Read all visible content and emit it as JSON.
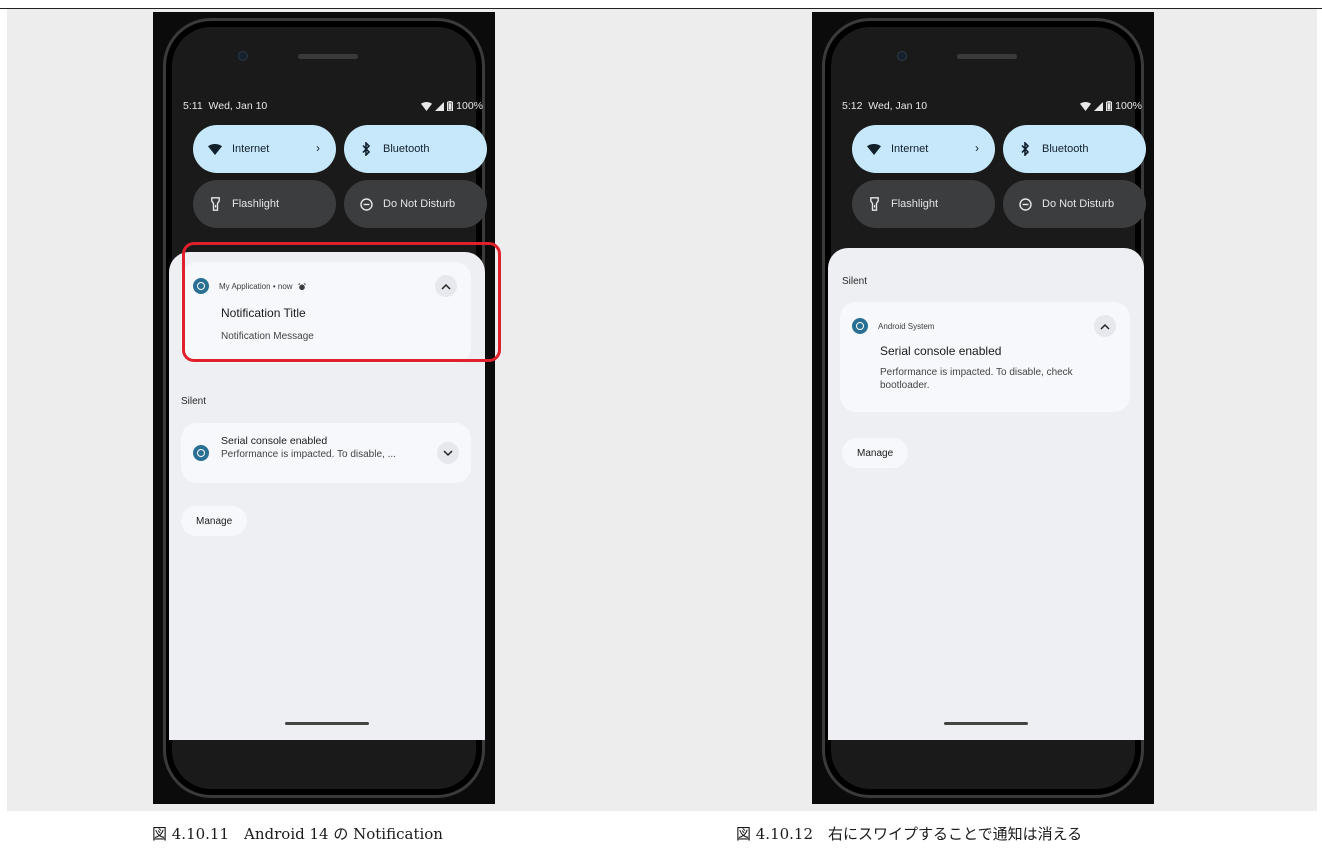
{
  "left": {
    "status": {
      "time": "5:11",
      "date": "Wed, Jan 10",
      "battery": "100%"
    },
    "tiles": {
      "internet": "Internet",
      "bluetooth": "Bluetooth",
      "flashlight": "Flashlight",
      "dnd": "Do Not Disturb"
    },
    "notification": {
      "app": "My Application",
      "separator": "•",
      "when": "now",
      "title": "Notification Title",
      "message": "Notification Message"
    },
    "silent_label": "Silent",
    "silent_notification": {
      "title": "Serial console enabled",
      "message": "Performance is impacted. To disable, ..."
    },
    "manage": "Manage",
    "caption": "図 4.10.11　Android 14 の Notification"
  },
  "right": {
    "status": {
      "time": "5:12",
      "date": "Wed, Jan 10",
      "battery": "100%"
    },
    "tiles": {
      "internet": "Internet",
      "bluetooth": "Bluetooth",
      "flashlight": "Flashlight",
      "dnd": "Do Not Disturb"
    },
    "silent_label": "Silent",
    "notification": {
      "app": "Android System",
      "title": "Serial console enabled",
      "message_line1": "Performance is impacted. To disable, check",
      "message_line2": "bootloader."
    },
    "manage": "Manage",
    "caption": "図 4.10.12　右にスワイプすることで通知は消える"
  },
  "colors": {
    "tile_on": "#c7e8fb",
    "tile_off": "#3b3d3f",
    "highlight": "#e0212b",
    "app_icon": "#2a6f94"
  },
  "icons": [
    "wifi-icon",
    "cell-signal-icon",
    "battery-icon",
    "bluetooth-icon",
    "flashlight-icon",
    "do-not-disturb-icon",
    "chevron-right-icon",
    "chevron-up-icon",
    "chevron-down-icon",
    "app-icon",
    "alarm-icon"
  ]
}
